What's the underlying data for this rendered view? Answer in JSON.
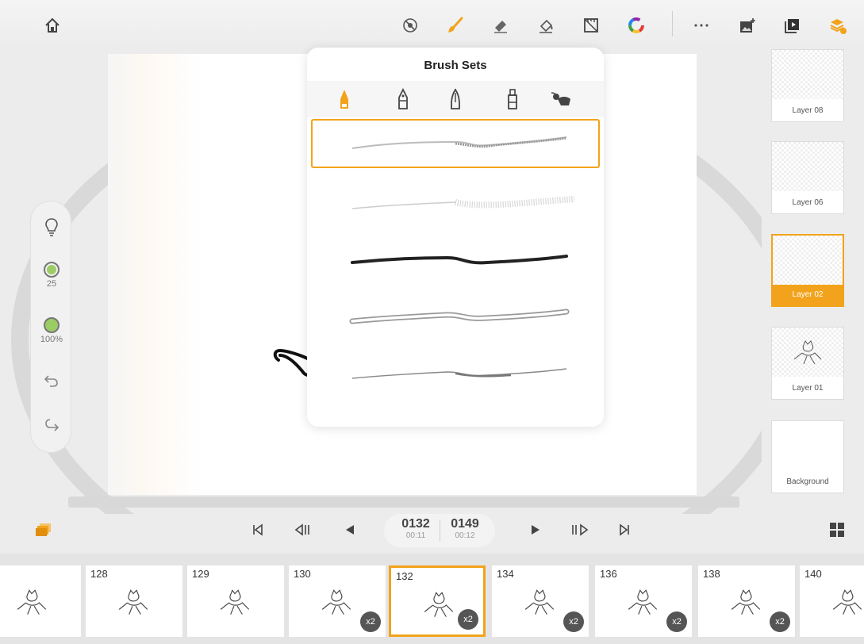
{
  "colors": {
    "accent": "#f2a31b",
    "brush_green": "#9ccc65"
  },
  "toolbar": {
    "home_icon": "home-icon",
    "tools": [
      "symmetry-icon",
      "brush-icon",
      "eraser-icon",
      "fill-icon",
      "ruler-icon",
      "color-wheel-icon"
    ],
    "right": [
      "more-icon",
      "add-image-icon",
      "playback-icon",
      "layers-icon"
    ]
  },
  "sidebar": {
    "size_value": "25",
    "opacity_value": "100%"
  },
  "brush_sets": {
    "title": "Brush Sets"
  },
  "layers": [
    {
      "name": "Layer 08"
    },
    {
      "name": "Layer 06"
    },
    {
      "name": "Layer 02"
    },
    {
      "name": "Layer 01"
    },
    {
      "name": "Background"
    }
  ],
  "playback": {
    "current_frame": "0132",
    "current_time": "00:11",
    "total_frames": "0149",
    "total_time": "00:12"
  },
  "timeline": {
    "frames": [
      {
        "number": "",
        "badge": ""
      },
      {
        "number": "128",
        "badge": ""
      },
      {
        "number": "129",
        "badge": ""
      },
      {
        "number": "130",
        "badge": "x2"
      },
      {
        "number": "132",
        "badge": "x2"
      },
      {
        "number": "134",
        "badge": "x2"
      },
      {
        "number": "136",
        "badge": "x2"
      },
      {
        "number": "138",
        "badge": "x2"
      },
      {
        "number": "140",
        "badge": ""
      }
    ]
  }
}
